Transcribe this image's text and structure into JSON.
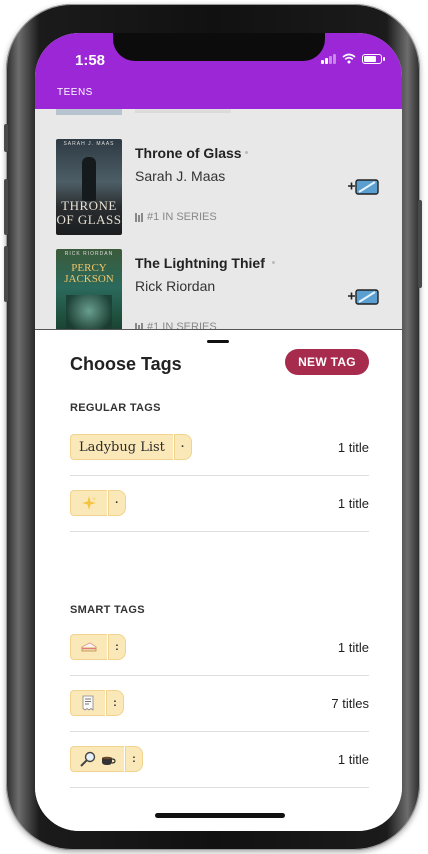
{
  "status_bar": {
    "time": "1:58"
  },
  "header": {
    "section_title": "TEENS"
  },
  "books": [
    {
      "title": "Throne of Glass",
      "author": "Sarah J. Maas",
      "series": "#1 IN SERIES",
      "cover_author": "SARAH J. MAAS",
      "cover_title": "THRONE OF GLASS"
    },
    {
      "title": "The Lightning Thief",
      "author": "Rick Riordan",
      "series": "#1 IN SERIES",
      "cover_author": "RICK RIORDAN",
      "cover_title": "PERCY JACKSON"
    }
  ],
  "sheet": {
    "title": "Choose Tags",
    "new_tag_label": "NEW TAG",
    "regular_label": "REGULAR TAGS",
    "smart_label": "SMART TAGS",
    "regular_tags": [
      {
        "name": "Ladybug List",
        "count": "1 title",
        "icon": null
      },
      {
        "name": "",
        "count": "1 title",
        "icon": "sparkles-icon"
      }
    ],
    "smart_tags": [
      {
        "name": "",
        "count": "1 title",
        "icon": "cake-icon"
      },
      {
        "name": "",
        "count": "7 titles",
        "icon": "receipt-icon"
      },
      {
        "name": "",
        "count": "1 title",
        "icon": "magnifier-coffee-icon"
      }
    ]
  },
  "colors": {
    "header": "#9b27d6",
    "new_tag": "#a62b4d",
    "tag_fill": "#fbe8b8"
  }
}
